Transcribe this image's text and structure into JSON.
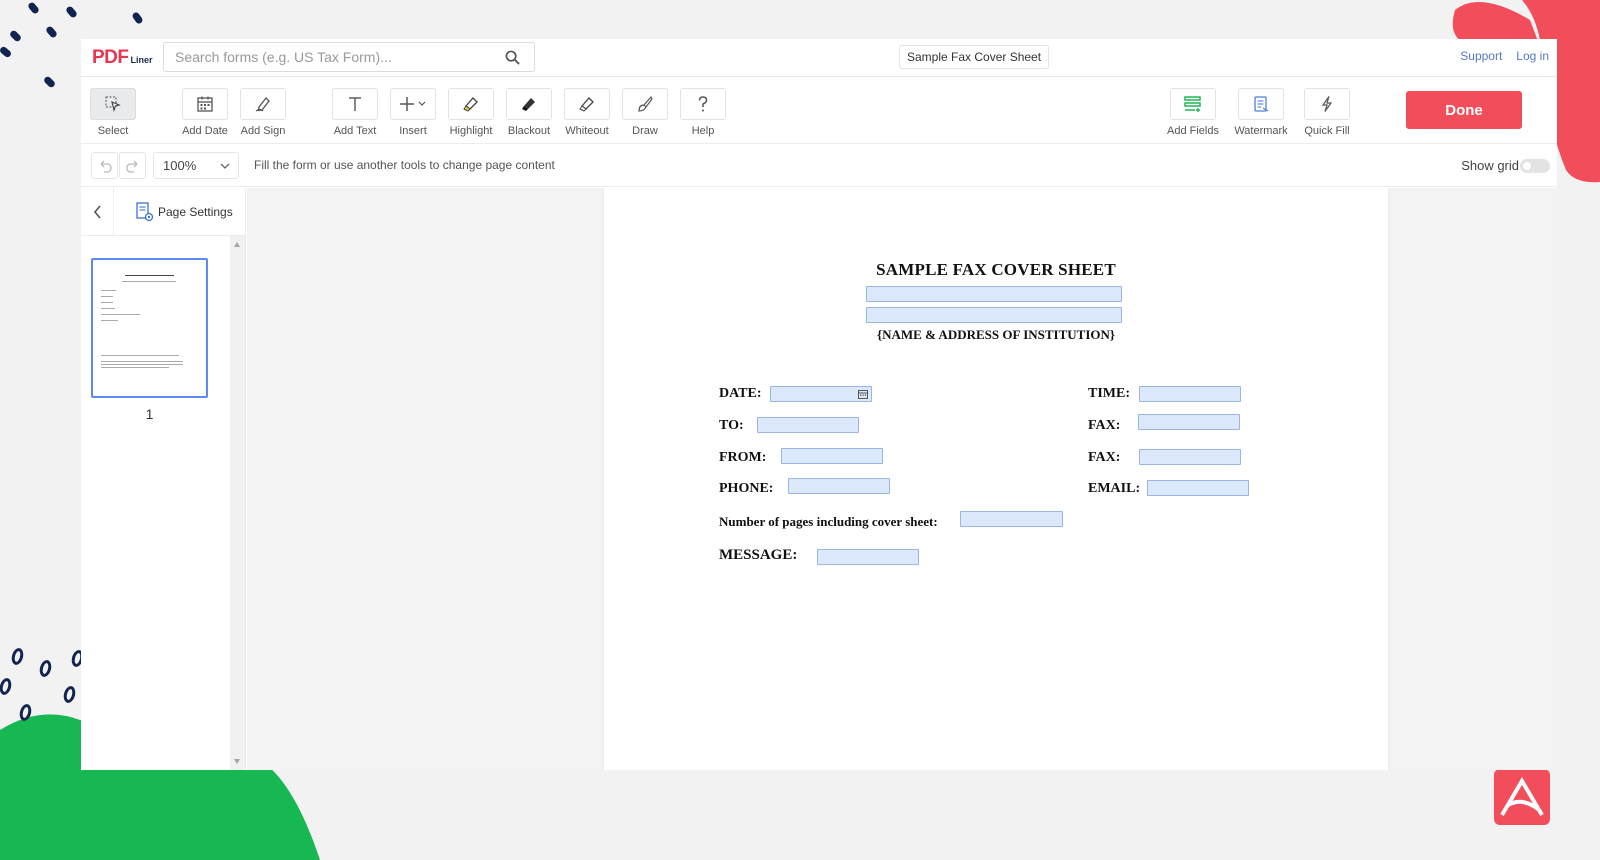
{
  "header": {
    "logo_pdf": "PDF",
    "logo_liner": "Liner",
    "search_placeholder": "Search forms (e.g. US Tax Form)...",
    "document_title": "Sample Fax Cover Sheet",
    "links": [
      "Support",
      "Log in"
    ]
  },
  "toolbar": {
    "tools": [
      {
        "label": "Select",
        "icon": "cursor-icon"
      },
      {
        "label": "Add Date",
        "icon": "calendar-icon"
      },
      {
        "label": "Add Sign",
        "icon": "signature-pen-icon"
      },
      {
        "label": "Add Text",
        "icon": "text-t-icon"
      },
      {
        "label": "Insert",
        "icon": "plus-icon"
      },
      {
        "label": "Highlight",
        "icon": "highlighter-icon"
      },
      {
        "label": "Blackout",
        "icon": "blackout-marker-icon"
      },
      {
        "label": "Whiteout",
        "icon": "whiteout-marker-icon"
      },
      {
        "label": "Draw",
        "icon": "brush-icon"
      },
      {
        "label": "Help",
        "icon": "question-icon"
      },
      {
        "label": "Add Fields",
        "icon": "form-fields-icon"
      },
      {
        "label": "Watermark",
        "icon": "watermark-doc-icon"
      },
      {
        "label": "Quick Fill",
        "icon": "lightning-icon"
      }
    ],
    "done_label": "Done"
  },
  "subbar": {
    "zoom": "100%",
    "hint": "Fill the form or use another tools to change page content",
    "show_grid_label": "Show grid",
    "show_grid_on": false
  },
  "sidebar": {
    "page_settings_label": "Page Settings",
    "pages": [
      "1"
    ]
  },
  "document": {
    "title": "SAMPLE FAX COVER SHEET",
    "subtitle": "{NAME & ADDRESS OF INSTITUTION}",
    "labels": {
      "date": "DATE:",
      "time": "TIME:",
      "to": "TO:",
      "fax1": "FAX:",
      "from": "FROM:",
      "fax2": "FAX:",
      "phone": "PHONE:",
      "email": "EMAIL:",
      "pages": "Number of pages including cover sheet:",
      "message": "MESSAGE:"
    }
  },
  "colors": {
    "accent": "#f24d5b",
    "link": "#5677c4",
    "field_fill": "#dce8fb",
    "field_border": "#9ab6e6",
    "decor_green": "#17b852",
    "decor_navy": "#11234f"
  }
}
